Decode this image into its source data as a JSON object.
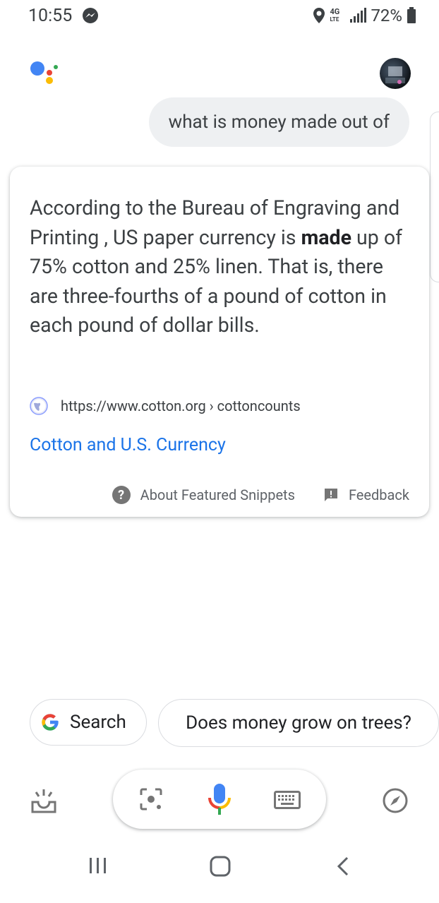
{
  "status_bar": {
    "time": "10:55",
    "network": "4G LTE",
    "battery": "72%",
    "icons": [
      "messenger-icon",
      "location-icon",
      "signal-icon",
      "battery-icon"
    ]
  },
  "conversation": {
    "user_query": "what is money made out of"
  },
  "snippet": {
    "text_before": "According to the Bureau of Engraving and Printing , US paper currency is ",
    "text_bold": "made",
    "text_after": " up of 75% cotton and 25% linen. That is, there are three-fourths of a pound of cotton in each pound of dollar bills.",
    "source_url": "https://www.cotton.org › cottoncounts",
    "link_title": "Cotton and U.S. Currency",
    "about_label": "About Featured Snippets",
    "feedback_label": "Feedback",
    "link_color": "#1a73e8"
  },
  "suggestions": {
    "search_label": "Search",
    "question_label": "Does money grow on trees?"
  },
  "toolbar": {
    "icons": [
      "updates-icon",
      "lens-icon",
      "mic-icon",
      "keyboard-icon",
      "compass-icon"
    ]
  },
  "nav_bar": {
    "icons": [
      "recents-icon",
      "home-icon",
      "back-icon"
    ]
  }
}
